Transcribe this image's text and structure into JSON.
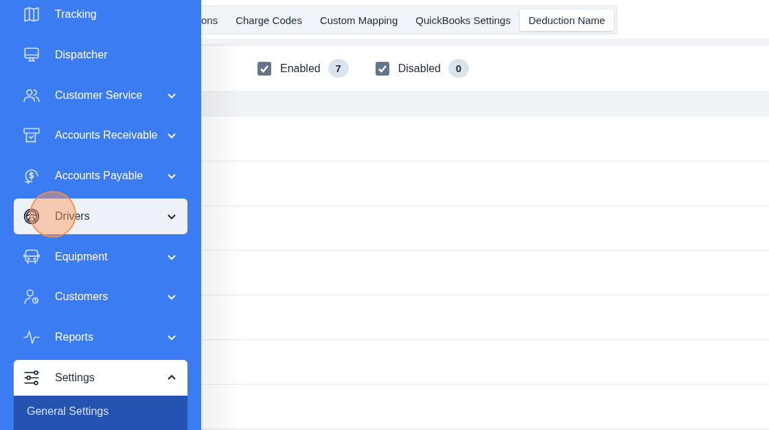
{
  "sidebar": {
    "items": [
      {
        "label": "Tracking",
        "expandable": false,
        "expanded": false,
        "highlighted": false
      },
      {
        "label": "Dispatcher",
        "expandable": false,
        "expanded": false,
        "highlighted": false
      },
      {
        "label": "Customer Service",
        "expandable": true,
        "expanded": false,
        "highlighted": false
      },
      {
        "label": "Accounts Receivable",
        "expandable": true,
        "expanded": false,
        "highlighted": false
      },
      {
        "label": "Accounts Payable",
        "expandable": true,
        "expanded": false,
        "highlighted": false
      },
      {
        "label": "Drivers",
        "expandable": true,
        "expanded": false,
        "highlighted": true
      },
      {
        "label": "Equipment",
        "expandable": true,
        "expanded": false,
        "highlighted": false
      },
      {
        "label": "Customers",
        "expandable": true,
        "expanded": false,
        "highlighted": false
      },
      {
        "label": "Reports",
        "expandable": true,
        "expanded": false,
        "highlighted": false
      },
      {
        "label": "Settings",
        "expandable": true,
        "expanded": true,
        "highlighted": false,
        "children": [
          {
            "label": "General Settings"
          }
        ]
      }
    ]
  },
  "tabs": [
    {
      "label": "ons",
      "selected": false
    },
    {
      "label": "Charge Codes",
      "selected": false
    },
    {
      "label": "Custom Mapping",
      "selected": false
    },
    {
      "label": "QuickBooks Settings",
      "selected": false
    },
    {
      "label": "Deduction Name",
      "selected": true
    }
  ],
  "filters": [
    {
      "label": "Enabled",
      "checked": true,
      "count": "7"
    },
    {
      "label": "Disabled",
      "checked": true,
      "count": "0"
    }
  ]
}
